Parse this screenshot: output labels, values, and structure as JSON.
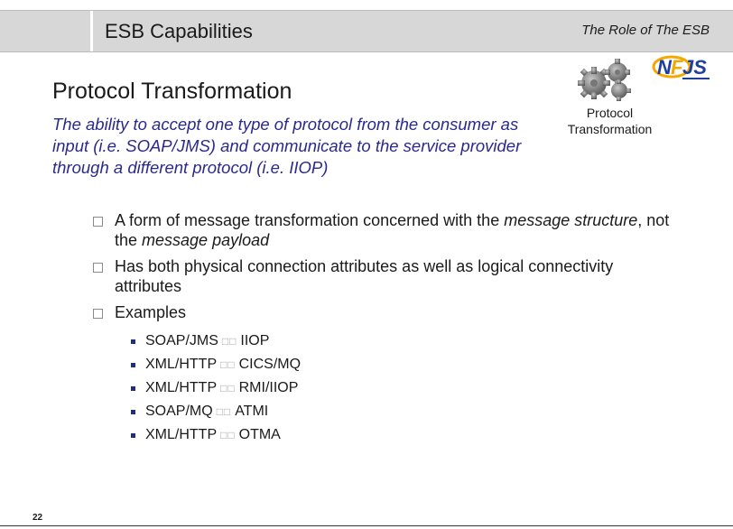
{
  "header": {
    "title": "ESB Capabilities",
    "subtitle": "The Role of The ESB"
  },
  "slide": {
    "title": "Protocol Transformation",
    "description": "The ability to accept one type of protocol from the consumer as input (i.e. SOAP/JMS) and communicate to the service provider through a different protocol (i.e. IIOP)",
    "icon_caption_line1": "Protocol",
    "icon_caption_line2": "Transformation",
    "icon": "gears-icon",
    "logo": "NFJS",
    "bullets": {
      "b1_prefix": "A form of message transformation concerned with the ",
      "b1_em1": "message structure",
      "b1_mid": ", not the ",
      "b1_em2": "message payload",
      "b2": "Has both physical connection attributes as well as logical connectivity attributes",
      "b3": "Examples"
    },
    "examples": [
      {
        "from": "SOAP/JMS",
        "arrow": "□□",
        "to": "IIOP"
      },
      {
        "from": "XML/HTTP",
        "arrow": "□□",
        "to": "CICS/MQ"
      },
      {
        "from": "XML/HTTP",
        "arrow": "□□",
        "to": "RMI/IIOP"
      },
      {
        "from": "SOAP/MQ",
        "arrow": "□□",
        "to": "ATMI"
      },
      {
        "from": "XML/HTTP",
        "arrow": "□□",
        "to": "OTMA"
      }
    ],
    "page_number": "22"
  },
  "colors": {
    "header_bg": "#d7d7d7",
    "description_text": "#2a2a8a",
    "sub_bullet": "#1f2f7f"
  }
}
